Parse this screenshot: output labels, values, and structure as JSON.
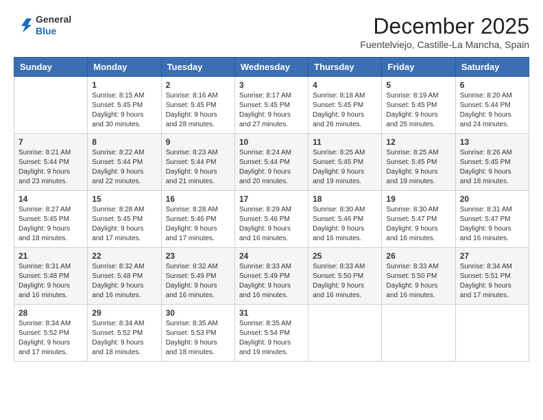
{
  "logo": {
    "general": "General",
    "blue": "Blue"
  },
  "title": "December 2025",
  "subtitle": "Fuentelviejo, Castille-La Mancha, Spain",
  "weekdays": [
    "Sunday",
    "Monday",
    "Tuesday",
    "Wednesday",
    "Thursday",
    "Friday",
    "Saturday"
  ],
  "weeks": [
    [
      {
        "day": "",
        "info": ""
      },
      {
        "day": "1",
        "info": "Sunrise: 8:15 AM\nSunset: 5:45 PM\nDaylight: 9 hours\nand 30 minutes."
      },
      {
        "day": "2",
        "info": "Sunrise: 8:16 AM\nSunset: 5:45 PM\nDaylight: 9 hours\nand 28 minutes."
      },
      {
        "day": "3",
        "info": "Sunrise: 8:17 AM\nSunset: 5:45 PM\nDaylight: 9 hours\nand 27 minutes."
      },
      {
        "day": "4",
        "info": "Sunrise: 8:18 AM\nSunset: 5:45 PM\nDaylight: 9 hours\nand 26 minutes."
      },
      {
        "day": "5",
        "info": "Sunrise: 8:19 AM\nSunset: 5:45 PM\nDaylight: 9 hours\nand 25 minutes."
      },
      {
        "day": "6",
        "info": "Sunrise: 8:20 AM\nSunset: 5:44 PM\nDaylight: 9 hours\nand 24 minutes."
      }
    ],
    [
      {
        "day": "7",
        "info": "Sunrise: 8:21 AM\nSunset: 5:44 PM\nDaylight: 9 hours\nand 23 minutes."
      },
      {
        "day": "8",
        "info": "Sunrise: 8:22 AM\nSunset: 5:44 PM\nDaylight: 9 hours\nand 22 minutes."
      },
      {
        "day": "9",
        "info": "Sunrise: 8:23 AM\nSunset: 5:44 PM\nDaylight: 9 hours\nand 21 minutes."
      },
      {
        "day": "10",
        "info": "Sunrise: 8:24 AM\nSunset: 5:44 PM\nDaylight: 9 hours\nand 20 minutes."
      },
      {
        "day": "11",
        "info": "Sunrise: 8:25 AM\nSunset: 5:45 PM\nDaylight: 9 hours\nand 19 minutes."
      },
      {
        "day": "12",
        "info": "Sunrise: 8:25 AM\nSunset: 5:45 PM\nDaylight: 9 hours\nand 19 minutes."
      },
      {
        "day": "13",
        "info": "Sunrise: 8:26 AM\nSunset: 5:45 PM\nDaylight: 9 hours\nand 18 minutes."
      }
    ],
    [
      {
        "day": "14",
        "info": "Sunrise: 8:27 AM\nSunset: 5:45 PM\nDaylight: 9 hours\nand 18 minutes."
      },
      {
        "day": "15",
        "info": "Sunrise: 8:28 AM\nSunset: 5:45 PM\nDaylight: 9 hours\nand 17 minutes."
      },
      {
        "day": "16",
        "info": "Sunrise: 8:28 AM\nSunset: 5:46 PM\nDaylight: 9 hours\nand 17 minutes."
      },
      {
        "day": "17",
        "info": "Sunrise: 8:29 AM\nSunset: 5:46 PM\nDaylight: 9 hours\nand 16 minutes."
      },
      {
        "day": "18",
        "info": "Sunrise: 8:30 AM\nSunset: 5:46 PM\nDaylight: 9 hours\nand 16 minutes."
      },
      {
        "day": "19",
        "info": "Sunrise: 8:30 AM\nSunset: 5:47 PM\nDaylight: 9 hours\nand 16 minutes."
      },
      {
        "day": "20",
        "info": "Sunrise: 8:31 AM\nSunset: 5:47 PM\nDaylight: 9 hours\nand 16 minutes."
      }
    ],
    [
      {
        "day": "21",
        "info": "Sunrise: 8:31 AM\nSunset: 5:48 PM\nDaylight: 9 hours\nand 16 minutes."
      },
      {
        "day": "22",
        "info": "Sunrise: 8:32 AM\nSunset: 5:48 PM\nDaylight: 9 hours\nand 16 minutes."
      },
      {
        "day": "23",
        "info": "Sunrise: 8:32 AM\nSunset: 5:49 PM\nDaylight: 9 hours\nand 16 minutes."
      },
      {
        "day": "24",
        "info": "Sunrise: 8:33 AM\nSunset: 5:49 PM\nDaylight: 9 hours\nand 16 minutes."
      },
      {
        "day": "25",
        "info": "Sunrise: 8:33 AM\nSunset: 5:50 PM\nDaylight: 9 hours\nand 16 minutes."
      },
      {
        "day": "26",
        "info": "Sunrise: 8:33 AM\nSunset: 5:50 PM\nDaylight: 9 hours\nand 16 minutes."
      },
      {
        "day": "27",
        "info": "Sunrise: 8:34 AM\nSunset: 5:51 PM\nDaylight: 9 hours\nand 17 minutes."
      }
    ],
    [
      {
        "day": "28",
        "info": "Sunrise: 8:34 AM\nSunset: 5:52 PM\nDaylight: 9 hours\nand 17 minutes."
      },
      {
        "day": "29",
        "info": "Sunrise: 8:34 AM\nSunset: 5:52 PM\nDaylight: 9 hours\nand 18 minutes."
      },
      {
        "day": "30",
        "info": "Sunrise: 8:35 AM\nSunset: 5:53 PM\nDaylight: 9 hours\nand 18 minutes."
      },
      {
        "day": "31",
        "info": "Sunrise: 8:35 AM\nSunset: 5:54 PM\nDaylight: 9 hours\nand 19 minutes."
      },
      {
        "day": "",
        "info": ""
      },
      {
        "day": "",
        "info": ""
      },
      {
        "day": "",
        "info": ""
      }
    ]
  ]
}
